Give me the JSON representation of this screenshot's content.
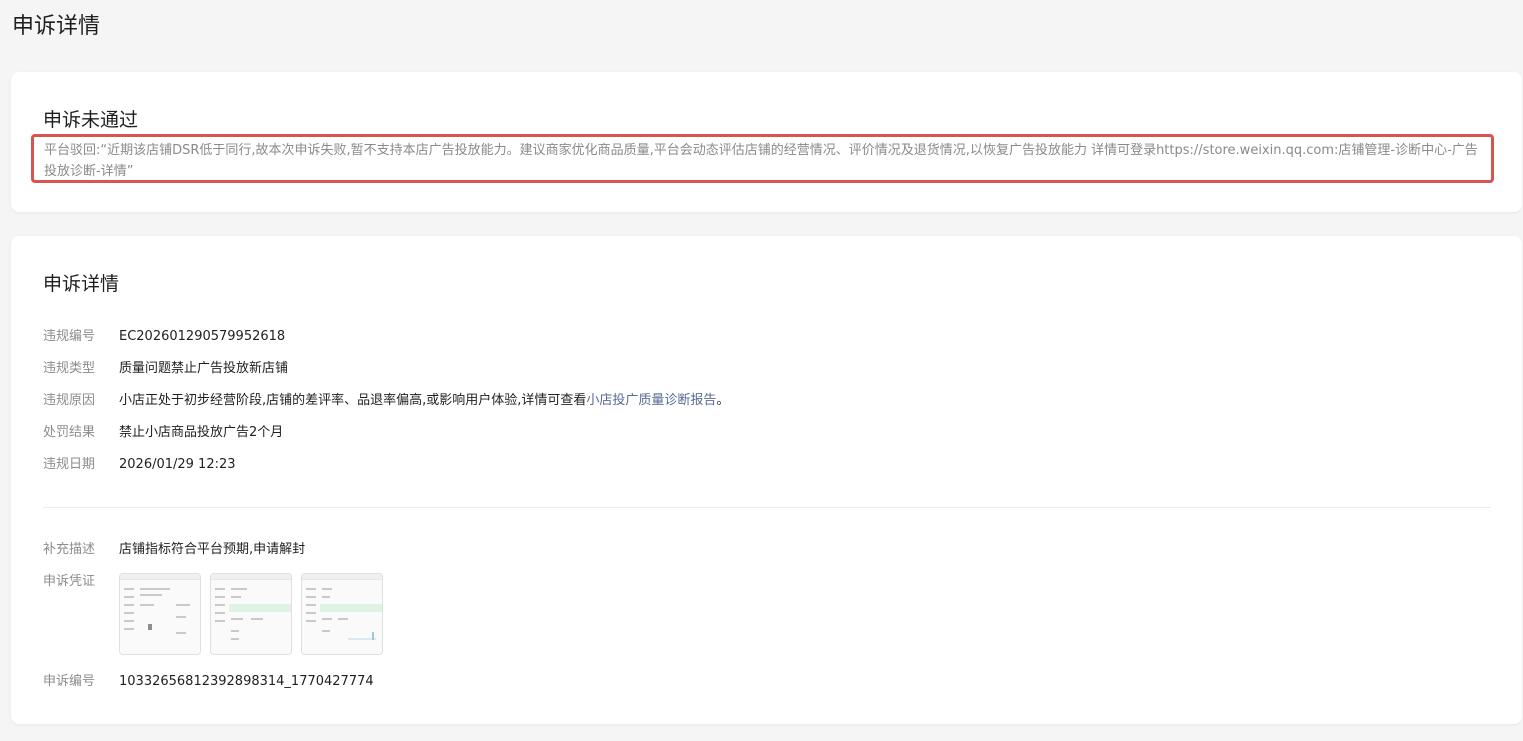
{
  "page": {
    "title": "申诉详情"
  },
  "status_card": {
    "title": "申诉未通过",
    "reject_reason": "平台驳回:“近期该店铺DSR低于同行,故本次申诉失败,暂不支持本店广告投放能力。建议商家优化商品质量,平台会动态评估店铺的经营情况、评价情况及退货情况,以恢复广告投放能力 详情可登录https://store.weixin.qq.com:店铺管理-诊断中心-广告投放诊断-详情”"
  },
  "detail_card": {
    "title": "申诉详情",
    "violation_no_label": "违规编号",
    "violation_no": "EC202601290579952618",
    "violation_type_label": "违规类型",
    "violation_type": "质量问题禁止广告投放新店铺",
    "violation_reason_label": "违规原因",
    "violation_reason": "小店正处于初步经营阶段,店铺的差评率、品退率偏高,或影响用户体验,详情可查看",
    "violation_reason_link": "小店投广质量诊断报告",
    "violation_reason_end": "。",
    "penalty_label": "处罚结果",
    "penalty": "禁止小店商品投放广告2个月",
    "violation_date_label": "违规日期",
    "violation_date": "2026/01/29 12:23",
    "supplement_label": "补充描述",
    "supplement": "店铺指标符合平台预期,申请解封",
    "evidence_label": "申诉凭证",
    "appeal_no_label": "申诉编号",
    "appeal_no": "10332656812392898314_1770427774"
  },
  "colors": {
    "background": "#f5f5f5",
    "card": "#ffffff",
    "reject_border": "#d9534f",
    "link": "#576b95",
    "label": "#8c8c8c"
  }
}
